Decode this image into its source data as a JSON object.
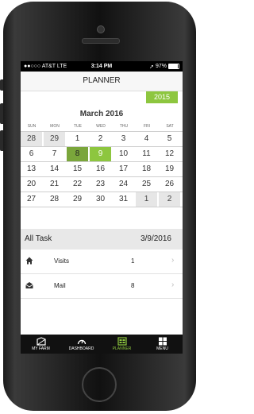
{
  "status_bar": {
    "carrier": "●●○○○ AT&T  LTE",
    "time": "3:14 PM",
    "battery": "97%"
  },
  "nav": {
    "title": "PLANNER"
  },
  "year_button": "2015",
  "calendar": {
    "month_title": "March 2016",
    "weekdays": [
      "SUN",
      "MON",
      "TUE",
      "WED",
      "THU",
      "FRI",
      "SAT"
    ],
    "weeks": [
      [
        "28",
        "29",
        "1",
        "2",
        "3",
        "4",
        "5"
      ],
      [
        "6",
        "7",
        "8",
        "9",
        "10",
        "11",
        "12"
      ],
      [
        "13",
        "14",
        "15",
        "16",
        "17",
        "18",
        "19"
      ],
      [
        "20",
        "21",
        "22",
        "23",
        "24",
        "25",
        "26"
      ],
      [
        "27",
        "28",
        "29",
        "30",
        "31",
        "1",
        "2"
      ]
    ]
  },
  "tasks": {
    "header": "All Task",
    "date": "3/9/2016",
    "rows": [
      {
        "label": "Visits",
        "count": "1",
        "icon": "home-icon"
      },
      {
        "label": "Mail",
        "count": "8",
        "icon": "mail-icon"
      }
    ]
  },
  "tabbar": {
    "items": [
      {
        "label": "MY FARM",
        "icon": "farm-icon"
      },
      {
        "label": "DASHBOARD",
        "icon": "gauge-icon"
      },
      {
        "label": "PLANNER",
        "icon": "planner-icon"
      },
      {
        "label": "MENU",
        "icon": "grid-icon"
      }
    ],
    "active_color": "#8dc63f"
  }
}
